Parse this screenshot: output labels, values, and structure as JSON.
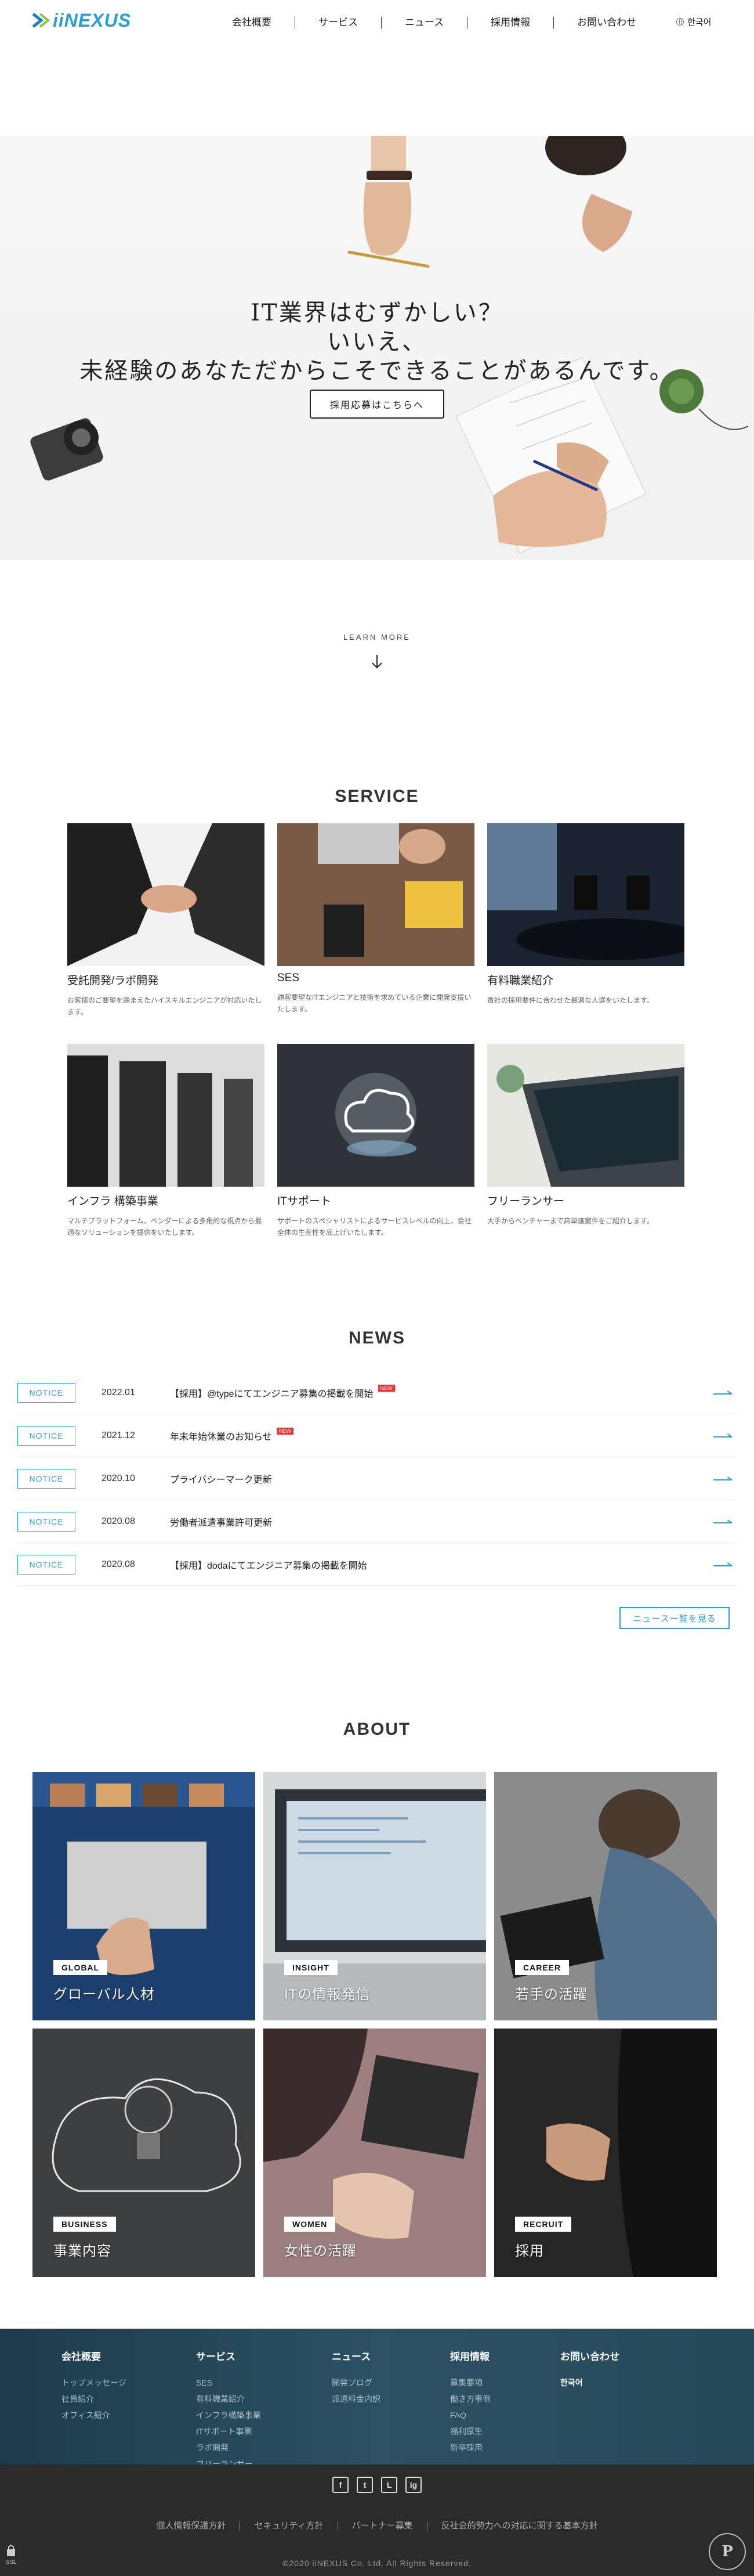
{
  "header": {
    "logo": "iiNEXUS",
    "nav": [
      "会社概要",
      "サービス",
      "ニュース",
      "採用情報",
      "お問い合わせ"
    ],
    "lang": "한국어"
  },
  "hero": {
    "line1": "IT業界はむずかしい？",
    "line2": "いいえ、",
    "line3": "未経験のあなただからこそできることがあるんです。",
    "button": "採用応募はこちらへ"
  },
  "learn_more": "LEARN MORE",
  "service": {
    "title": "SERVICE",
    "items": [
      {
        "title": "受託開発/ラボ開発",
        "desc": "お客様のご要望を踏まえたハイスキルエンジニアが対応いたします。"
      },
      {
        "title": "SES",
        "desc": "顧客要望なITエンジニアと技術を求めている企業に開発支援いたします。"
      },
      {
        "title": "有料職業紹介",
        "desc": "貴社の採用要件に合わせた最適な人選をいたします。"
      },
      {
        "title": "インフラ 構築事業",
        "desc": "マルチプラットフォーム、ベンダーによる多角的な視点から最適なソリューションを提供をいたします。"
      },
      {
        "title": "ITサポート",
        "desc": "サポートのスペシャリストによるサービスレベルの向上、会社全体の生産性を底上げいたします。"
      },
      {
        "title": "フリーランサー",
        "desc": "大手からベンチャーまで高単価案件をご紹介します。"
      }
    ]
  },
  "news": {
    "title": "NEWS",
    "items": [
      {
        "badge": "NOTICE",
        "date": "2022.01",
        "text": "【採用】@typeにてエンジニア募集の掲載を開始",
        "new": "NEW"
      },
      {
        "badge": "NOTICE",
        "date": "2021.12",
        "text": "年末年始休業のお知らせ",
        "new": "NEW"
      },
      {
        "badge": "NOTICE",
        "date": "2020.10",
        "text": "プライバシーマーク更新",
        "new": ""
      },
      {
        "badge": "NOTICE",
        "date": "2020.08",
        "text": "労働者派遣事業許可更新",
        "new": ""
      },
      {
        "badge": "NOTICE",
        "date": "2020.08",
        "text": "【採用】dodaにてエンジニア募集の掲載を開始",
        "new": ""
      }
    ],
    "more": "ニュース一覧を見る"
  },
  "about": {
    "title": "ABOUT",
    "items": [
      {
        "tag": "GLOBAL",
        "label": "グローバル人材"
      },
      {
        "tag": "INSIGHT",
        "label": "ITの情報発信"
      },
      {
        "tag": "CAREER",
        "label": "若手の活躍"
      },
      {
        "tag": "BUSINESS",
        "label": "事業内容"
      },
      {
        "tag": "WOMEN",
        "label": "女性の活躍"
      },
      {
        "tag": "RECRUIT",
        "label": "採用"
      }
    ]
  },
  "footer": {
    "cols": [
      {
        "head": "会社概要",
        "links": [
          "トップメッセージ",
          "社員紹介",
          "オフィス紹介"
        ]
      },
      {
        "head": "サービス",
        "links": [
          "SES",
          "有料職業紹介",
          "インフラ構築事業",
          "ITサポート事業",
          "ラボ開発",
          "フリーランサー"
        ]
      },
      {
        "head": "ニュース",
        "links": [
          "開発ブログ",
          "派遣料金内訳"
        ]
      },
      {
        "head": "採用情報",
        "links": [
          "募集要項",
          "働き方事例",
          "FAQ",
          "福利厚生",
          "新卒採用"
        ]
      },
      {
        "head": "お問い合わせ",
        "links": [
          "한국어"
        ]
      }
    ],
    "social": [
      "f",
      "t",
      "L",
      "ig"
    ],
    "links": [
      "個人情報保護方針",
      "セキュリティ方針",
      "パートナー募集",
      "反社会的勢力への対応に関する基本方針"
    ],
    "copyright": "©2020 iiNEXUS Co. Ltd. All Rights Reserved.",
    "ssl": "SSL",
    "privacy_mark": "P"
  },
  "colors": {
    "accent": "#2a9fd6",
    "footer_top": "#244a5a",
    "footer_bottom": "#2b2b2b"
  }
}
